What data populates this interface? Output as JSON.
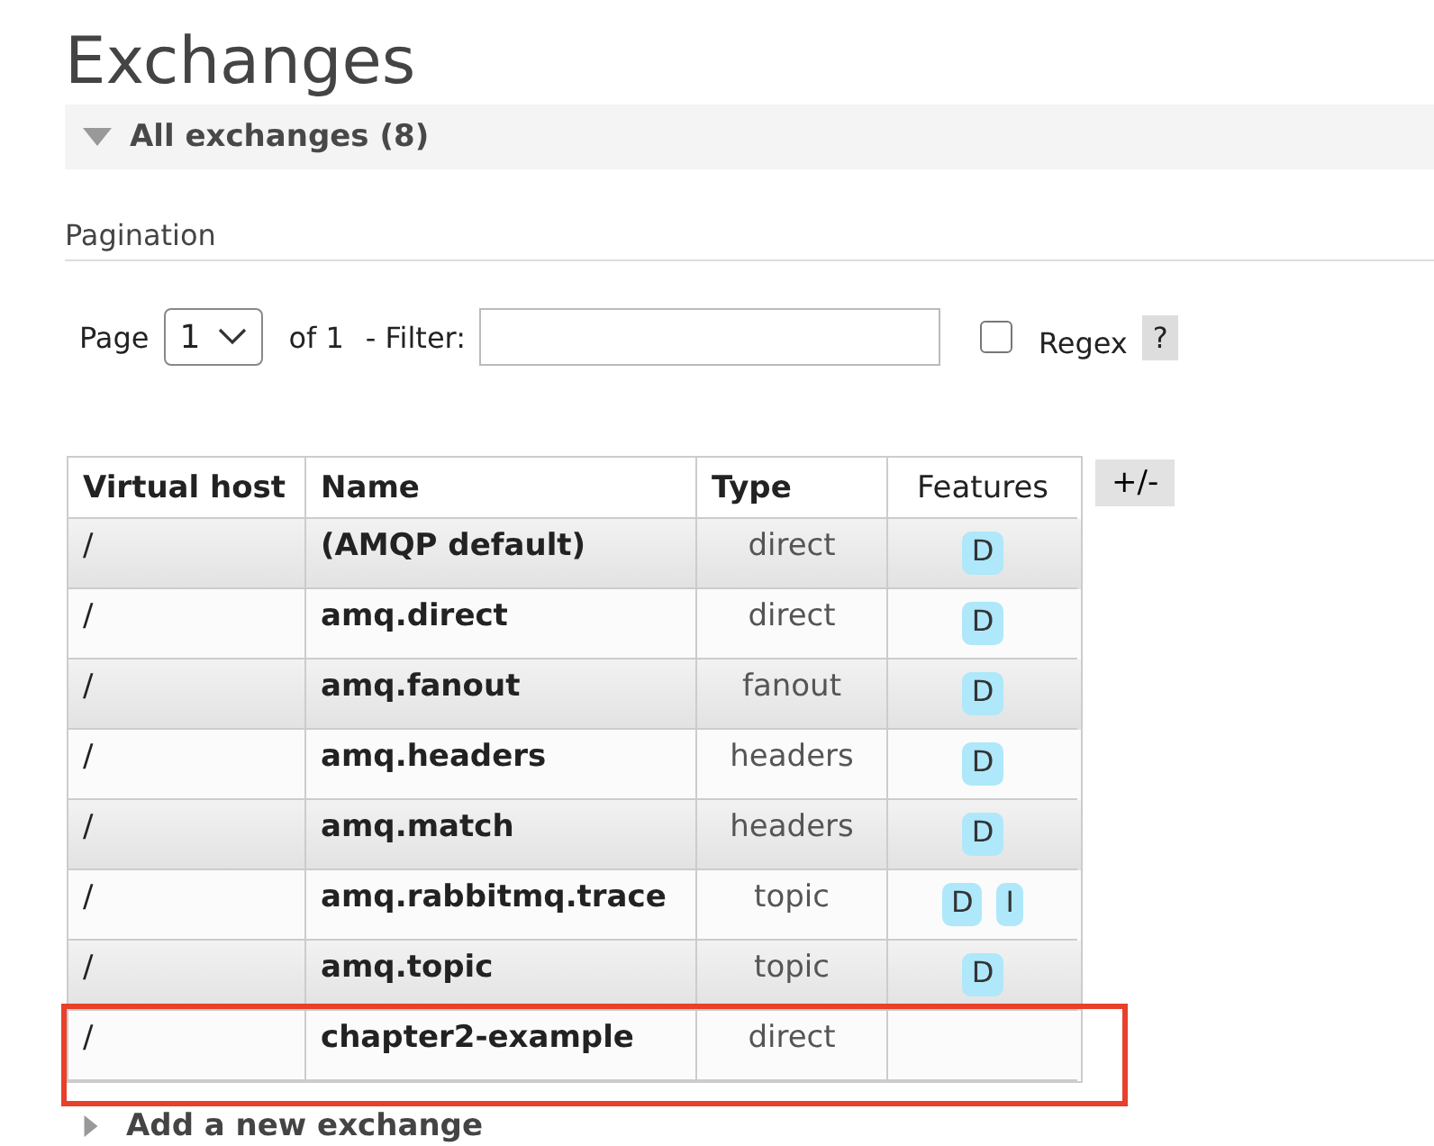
{
  "page_title": "Exchanges",
  "section": {
    "title": "All exchanges (8)",
    "expanded": true
  },
  "pagination": {
    "heading": "Pagination",
    "page_label": "Page",
    "page_value": "1",
    "of_label": "of 1",
    "filter_label": "- Filter:",
    "regex": {
      "label": "Regex",
      "checked": false
    },
    "help": "?"
  },
  "table": {
    "columns": [
      "Virtual host",
      "Name",
      "Type",
      "Features"
    ],
    "toggle": "+/-",
    "rows": [
      {
        "vhost": "/",
        "name": "(AMQP default)",
        "type": "direct",
        "features": [
          "D"
        ],
        "highlighted": false
      },
      {
        "vhost": "/",
        "name": "amq.direct",
        "type": "direct",
        "features": [
          "D"
        ],
        "highlighted": false
      },
      {
        "vhost": "/",
        "name": "amq.fanout",
        "type": "fanout",
        "features": [
          "D"
        ],
        "highlighted": false
      },
      {
        "vhost": "/",
        "name": "amq.headers",
        "type": "headers",
        "features": [
          "D"
        ],
        "highlighted": false
      },
      {
        "vhost": "/",
        "name": "amq.match",
        "type": "headers",
        "features": [
          "D"
        ],
        "highlighted": false
      },
      {
        "vhost": "/",
        "name": "amq.rabbitmq.trace",
        "type": "topic",
        "features": [
          "D",
          "I"
        ],
        "highlighted": false
      },
      {
        "vhost": "/",
        "name": "amq.topic",
        "type": "topic",
        "features": [
          "D"
        ],
        "highlighted": false
      },
      {
        "vhost": "/",
        "name": "chapter2-example",
        "type": "direct",
        "features": [],
        "highlighted": true
      }
    ]
  },
  "footer": {
    "title": "Add a new exchange",
    "expanded": false
  }
}
